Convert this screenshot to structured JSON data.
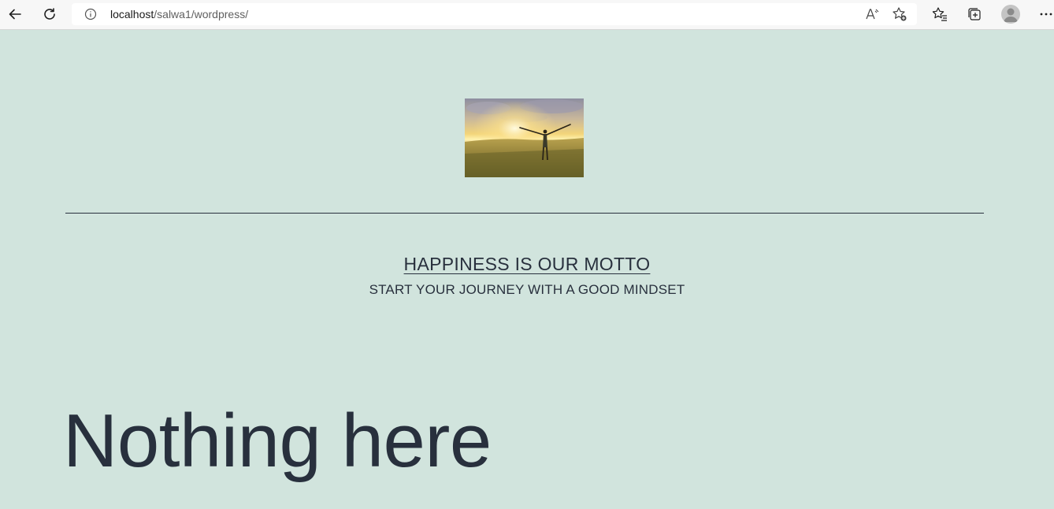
{
  "browser": {
    "url_host": "localhost",
    "url_path": "/salwa1/wordpress/",
    "icons": {
      "back": "back-arrow-icon",
      "refresh": "refresh-icon",
      "info": "info-icon",
      "read_aloud": "read-aloud-icon",
      "add_favorite": "add-favorite-icon",
      "favorites": "favorites-icon",
      "collections": "collections-icon",
      "profile": "profile-avatar",
      "more": "more-menu-icon"
    }
  },
  "site": {
    "title": "HAPPINESS IS OUR MOTTO",
    "description": "START YOUR JOURNEY WITH A GOOD MINDSET",
    "header_image": "person with raised arms in a grassy field at sunset"
  },
  "page": {
    "heading": "Nothing here"
  },
  "colors": {
    "background": "#d1e4dd",
    "text": "#28303d",
    "toolbar": "#f7f7f7"
  }
}
